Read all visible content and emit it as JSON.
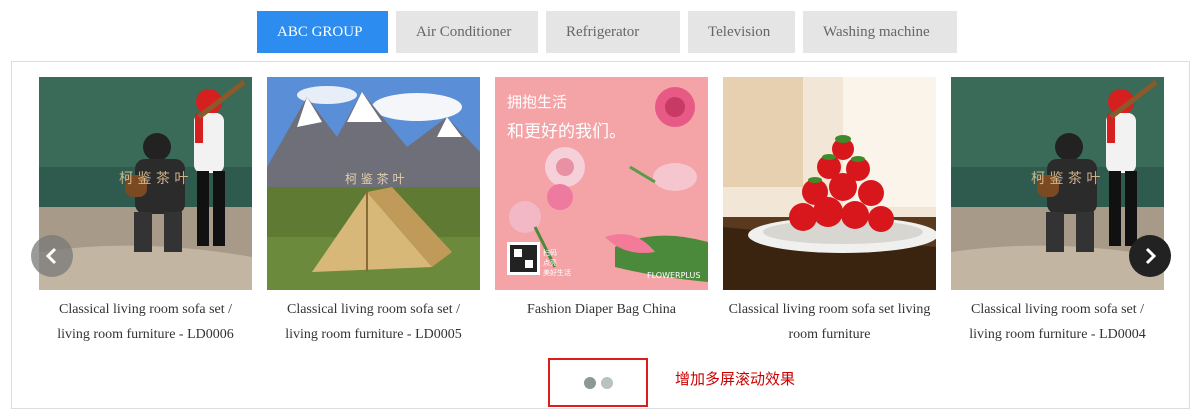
{
  "tabs": [
    {
      "label": "ABC GROUP",
      "active": true
    },
    {
      "label": "Air Conditioner",
      "active": false
    },
    {
      "label": "Refrigerator",
      "active": false
    },
    {
      "label": "Television",
      "active": false
    },
    {
      "label": "Washing machine",
      "active": false
    }
  ],
  "products": [
    {
      "caption": "Classical living room sofa set / living room furniture - LD0006",
      "image": "baseball-catcher-batter"
    },
    {
      "caption": "Classical living room sofa set / living room furniture - LD0005",
      "image": "tent-mountains"
    },
    {
      "caption": "Fashion Diaper Bag China",
      "image": "pink-flowers-poster"
    },
    {
      "caption": "Classical living room sofa set living room furniture",
      "image": "strawberries-plate"
    },
    {
      "caption": "Classical living room sofa set / living room furniture - LD0004",
      "image": "baseball-catcher-batter"
    }
  ],
  "poster": {
    "line1": "拥抱生活",
    "line2": "和更好的我们。",
    "qr_text": "扫码\n点亮\n美好生活",
    "brand": "FLOWERPLUS"
  },
  "watermark": "柯 鉴 茶 叶",
  "carousel": {
    "prev_icon": "chevron-left-icon",
    "next_icon": "chevron-right-icon",
    "page_count": 2,
    "active_page": 1
  },
  "annotation": "增加多屏滚动效果",
  "colors": {
    "accent": "#2d8cf0",
    "annotation": "#cc0000",
    "highlight_border": "#dd1c1c"
  }
}
